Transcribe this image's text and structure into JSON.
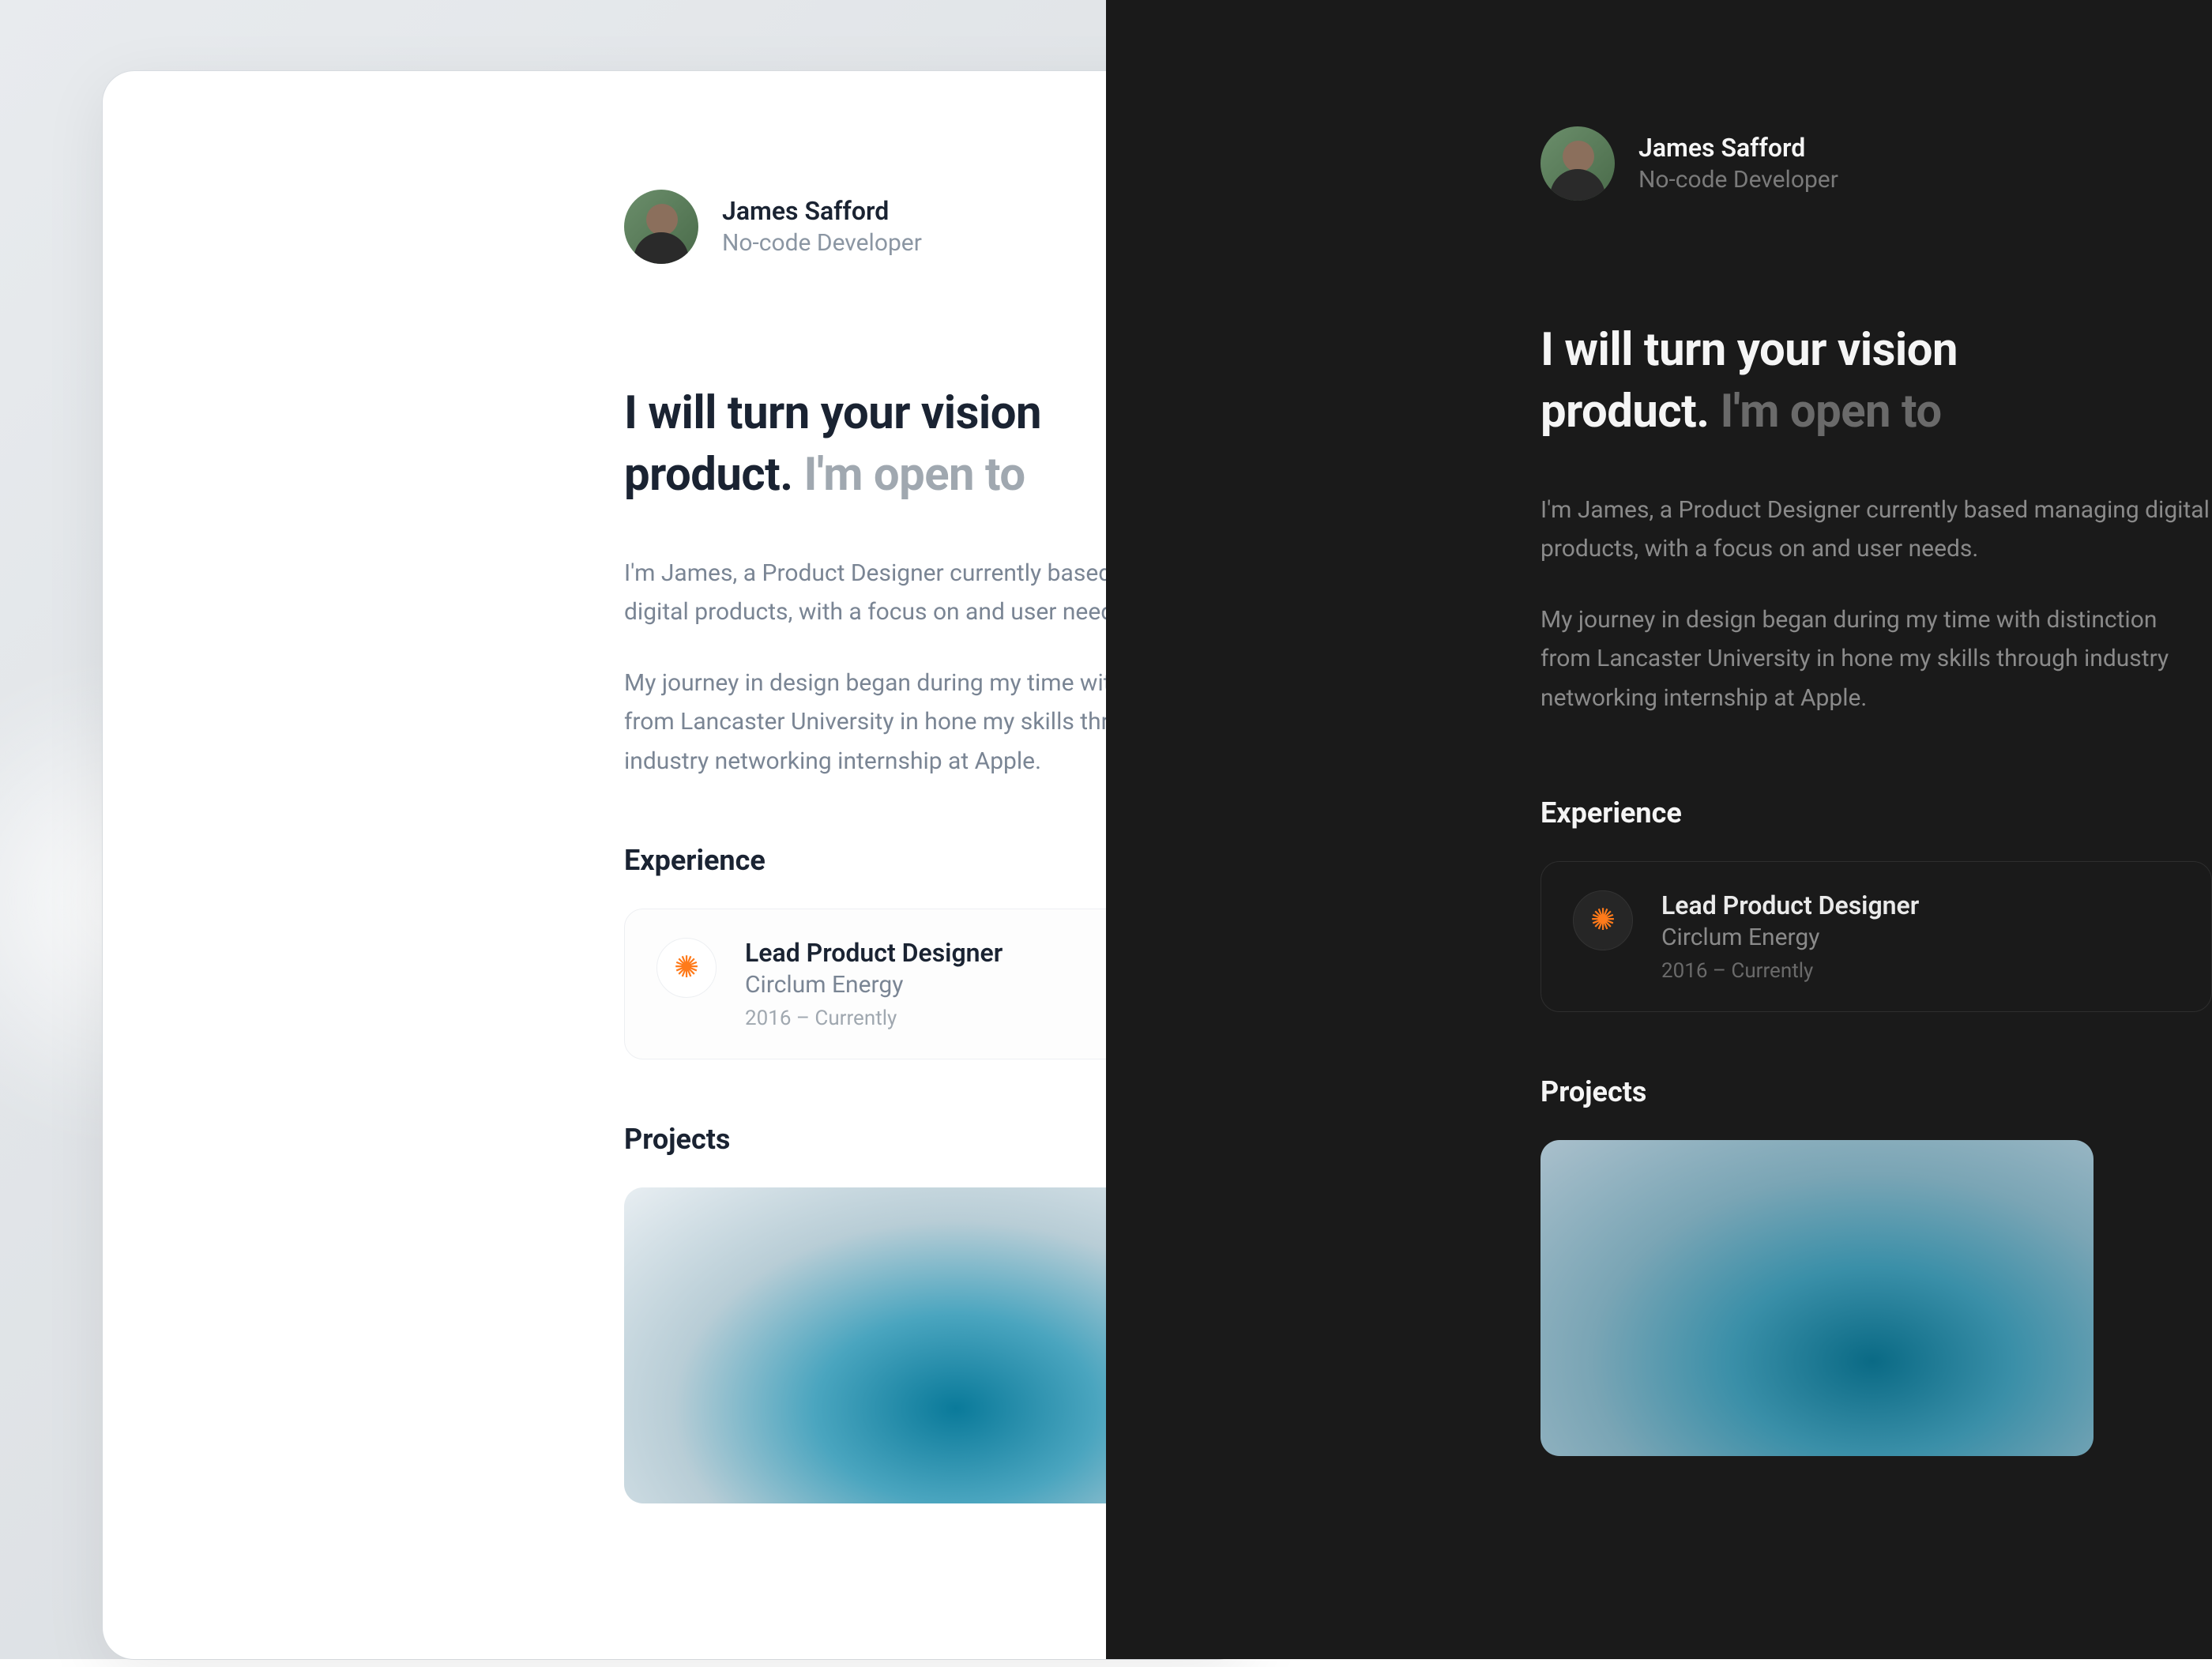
{
  "profile": {
    "name": "James Safford",
    "role": "No-code Developer"
  },
  "headline": {
    "part1": "I will turn your vision",
    "part2": "product.",
    "muted": "I'm open to"
  },
  "bio": {
    "p1": "I'm James, a Product Designer currently based managing digital products, with a focus on and user needs.",
    "p2": "My journey in design began during my time with distinction from Lancaster University in hone my skills through industry networking internship at Apple."
  },
  "sections": {
    "experience": "Experience",
    "projects": "Projects"
  },
  "experience": {
    "title": "Lead Product Designer",
    "company": "Circlum Energy",
    "dates": "2016 – Currently"
  },
  "colors": {
    "light_bg": "#ffffff",
    "dark_bg": "#1a1a1a",
    "accent_orange": "#ff7a1a",
    "text_dark_primary": "#1a2332",
    "text_dark_muted": "#7a8594",
    "text_light_primary": "#f5f5f5",
    "text_light_muted": "#8a8a8a"
  },
  "icons": {
    "company_logo": "sun-icon"
  }
}
